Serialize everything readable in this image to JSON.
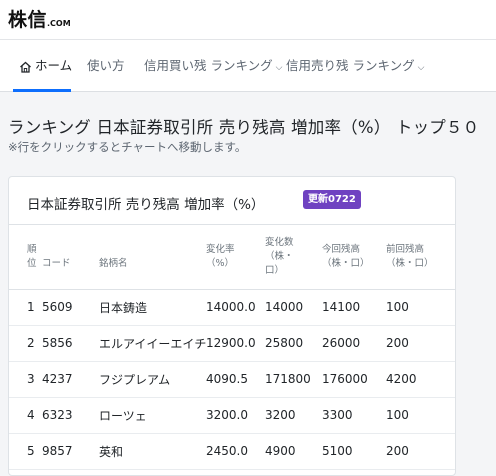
{
  "site": {
    "logo_text": "株信",
    "logo_suffix": ".COM"
  },
  "nav": {
    "items": [
      {
        "label": "ホーム",
        "icon": "home-icon",
        "active": true
      },
      {
        "label": "使い方"
      },
      {
        "label": "信用買い残 ランキング",
        "dropdown": true
      },
      {
        "label": "信用売り残 ランキング",
        "dropdown": true
      }
    ],
    "chevron": "⌵"
  },
  "page": {
    "title": "ランキング 日本証券取引所 売り残高 増加率（%） トップ５０",
    "note": "※行をクリックするとチャートへ移動します。"
  },
  "card": {
    "title": "日本証券取引所 売り残高 増加率（%）",
    "badge": "更新0722"
  },
  "table": {
    "headers": {
      "rank": [
        "順",
        "位"
      ],
      "code": [
        "コード"
      ],
      "name": [
        "銘柄名"
      ],
      "rate": [
        "変化率",
        "（%）"
      ],
      "diff": [
        "変化数",
        "（株・",
        "口）"
      ],
      "curr": [
        "今回残高",
        "（株・口）"
      ],
      "prev": [
        "前回残高",
        "（株・口）"
      ]
    },
    "rows": [
      {
        "rank": "1",
        "code": "5609",
        "name": "日本鋳造",
        "rate": "14000.0",
        "diff": "14000",
        "curr": "14100",
        "prev": "100"
      },
      {
        "rank": "2",
        "code": "5856",
        "name": "エルアイイーエイチ",
        "rate": "12900.0",
        "diff": "25800",
        "curr": "26000",
        "prev": "200"
      },
      {
        "rank": "3",
        "code": "4237",
        "name": "フジプレアム",
        "rate": "4090.5",
        "diff": "171800",
        "curr": "176000",
        "prev": "4200"
      },
      {
        "rank": "4",
        "code": "6323",
        "name": "ローツェ",
        "rate": "3200.0",
        "diff": "3200",
        "curr": "3300",
        "prev": "100"
      },
      {
        "rank": "5",
        "code": "9857",
        "name": "英和",
        "rate": "2450.0",
        "diff": "4900",
        "curr": "5100",
        "prev": "200"
      }
    ]
  },
  "colors": {
    "accent": "#0d6efd",
    "badge_bg": "#6f42c1"
  }
}
